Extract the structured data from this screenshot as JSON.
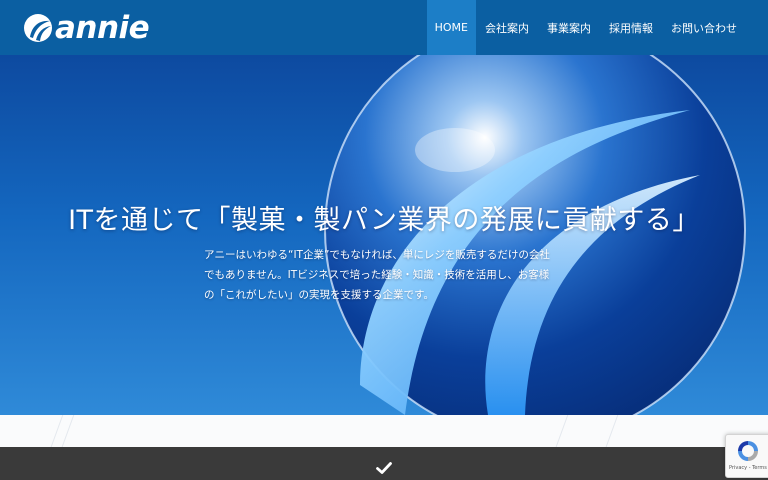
{
  "header": {
    "logo_text": "annie",
    "nav": [
      {
        "label": "HOME",
        "active": true
      },
      {
        "label": "会社案内"
      },
      {
        "label": "事業案内"
      },
      {
        "label": "採用情報"
      },
      {
        "label": "お問い合わせ"
      }
    ]
  },
  "hero": {
    "title": "ITを通じて「製菓・製パン業界の発展に貢献する」",
    "body_lines": [
      "アニーはいわゆる“IT企業”でもなければ、単にレジを販売するだけの会社",
      "でもありません。ITビジネスで培った経験・知識・技術を活用し、お客様",
      "の「これがしたい」の実現を支援する企業です。"
    ]
  },
  "footer_bar": {
    "icon": "check-icon"
  },
  "recaptcha": {
    "links": "Privacy - Terms"
  },
  "colors": {
    "header_bg": "#0b5fa2",
    "nav_active_bg": "#1c7ec7",
    "hero_top": "#0d4aa0",
    "hero_bottom": "#2f8ad8",
    "dark_bar": "#3a3a3a"
  }
}
